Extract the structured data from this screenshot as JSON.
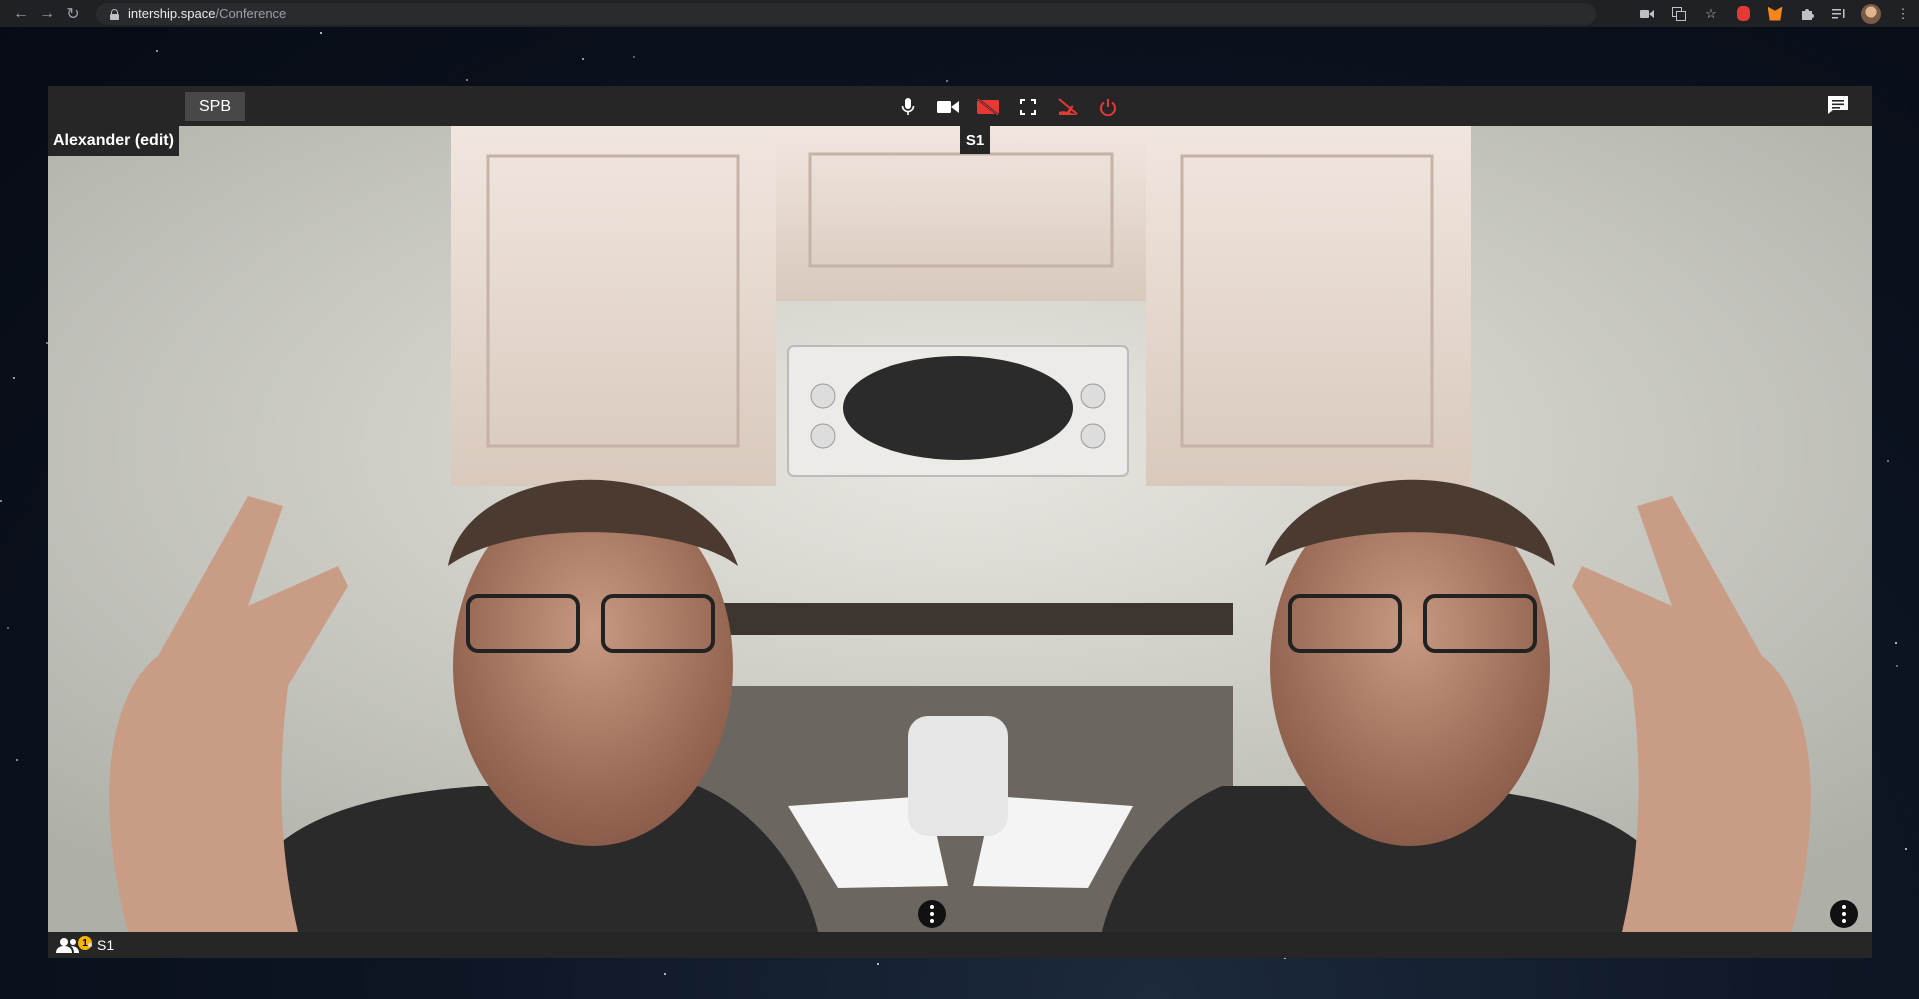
{
  "browser": {
    "url_host": "intership.space",
    "url_path": "/Conference"
  },
  "toolbar": {
    "room_label": "SPB",
    "controls": [
      {
        "name": "microphone",
        "color": "#ffffff"
      },
      {
        "name": "camera",
        "color": "#ffffff"
      },
      {
        "name": "screen-share-off",
        "color": "#e53935"
      },
      {
        "name": "fullscreen",
        "color": "#ffffff"
      },
      {
        "name": "hand-off",
        "color": "#e53935"
      },
      {
        "name": "power",
        "color": "#e53935"
      }
    ],
    "chat_icon": "chat-icon"
  },
  "video": {
    "participant_name": "Alexander (edit)",
    "stream_label": "S1"
  },
  "status": {
    "users_badge": "1",
    "stream_label": "S1"
  },
  "colors": {
    "accent_red": "#e53935",
    "badge_yellow": "#f5b400",
    "panel": "#262626"
  }
}
